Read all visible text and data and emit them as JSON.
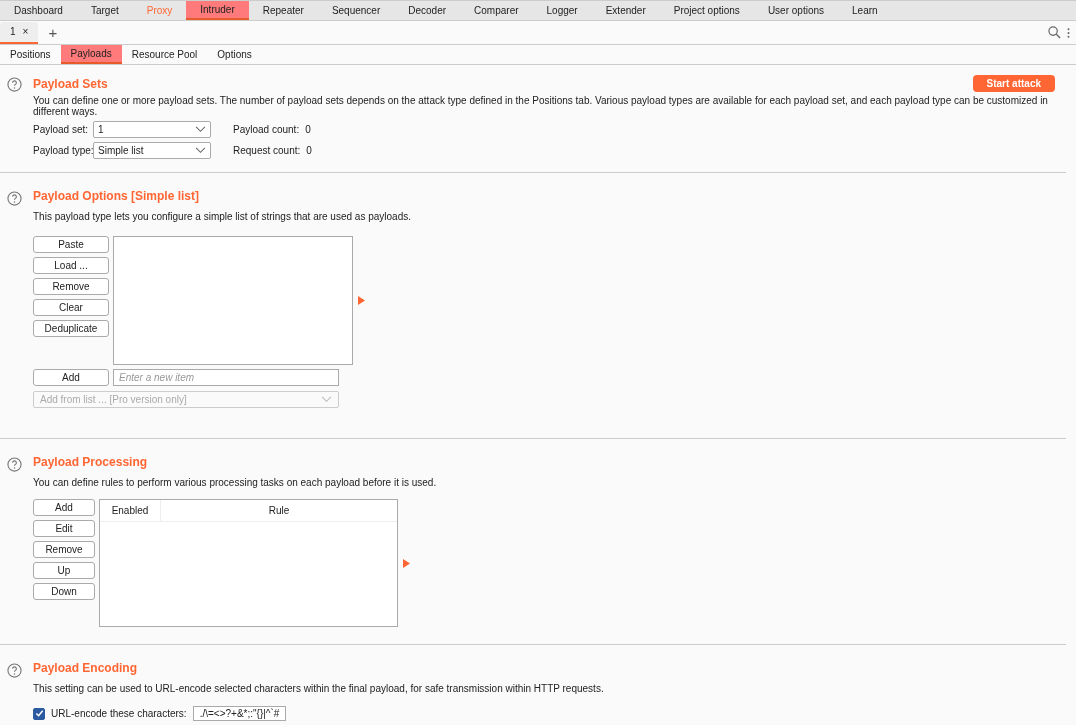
{
  "top_tabs": [
    {
      "label": "Dashboard",
      "selected": false,
      "highlighted": false
    },
    {
      "label": "Target",
      "selected": false,
      "highlighted": false
    },
    {
      "label": "Proxy",
      "selected": false,
      "highlighted": true
    },
    {
      "label": "Intruder",
      "selected": true,
      "highlighted": false
    },
    {
      "label": "Repeater",
      "selected": false,
      "highlighted": false
    },
    {
      "label": "Sequencer",
      "selected": false,
      "highlighted": false
    },
    {
      "label": "Decoder",
      "selected": false,
      "highlighted": false
    },
    {
      "label": "Comparer",
      "selected": false,
      "highlighted": false
    },
    {
      "label": "Logger",
      "selected": false,
      "highlighted": false
    },
    {
      "label": "Extender",
      "selected": false,
      "highlighted": false
    },
    {
      "label": "Project options",
      "selected": false,
      "highlighted": false
    },
    {
      "label": "User options",
      "selected": false,
      "highlighted": false
    },
    {
      "label": "Learn",
      "selected": false,
      "highlighted": false
    }
  ],
  "instance_tabs": [
    {
      "label": "1",
      "close": "×",
      "selected": true
    }
  ],
  "add_tab": "+",
  "sub_tabs": [
    {
      "label": "Positions",
      "selected": false
    },
    {
      "label": "Payloads",
      "selected": true
    },
    {
      "label": "Resource Pool",
      "selected": false
    },
    {
      "label": "Options",
      "selected": false
    }
  ],
  "payload_sets": {
    "title": "Payload Sets",
    "start_button": "Start attack",
    "description": "You can define one or more payload sets. The number of payload sets depends on the attack type defined in the Positions tab. Various payload types are available for each payload set, and each payload type can be customized in different ways.",
    "fields": [
      {
        "label": "Payload set:",
        "value": "1",
        "count_label": "Payload count:",
        "count": "0"
      },
      {
        "label": "Payload type:",
        "value": "Simple list",
        "count_label": "Request count:",
        "count": "0"
      }
    ]
  },
  "payload_options": {
    "title": "Payload Options [Simple list]",
    "description": "This payload type lets you configure a simple list of strings that are used as payloads.",
    "buttons": [
      "Paste",
      "Load ...",
      "Remove",
      "Clear",
      "Deduplicate"
    ],
    "add_button": "Add",
    "new_item_placeholder": "Enter a new item",
    "add_from_list": "Add from list ... [Pro version only]"
  },
  "payload_processing": {
    "title": "Payload Processing",
    "description": "You can define rules to perform various processing tasks on each payload before it is used.",
    "buttons": [
      "Add",
      "Edit",
      "Remove",
      "Up",
      "Down"
    ],
    "columns": [
      "Enabled",
      "Rule"
    ]
  },
  "payload_encoding": {
    "title": "Payload Encoding",
    "description": "This setting can be used to URL-encode selected characters within the final payload, for safe transmission within HTTP requests.",
    "checkbox_label": "URL-encode these characters:",
    "checked": true,
    "characters": "./\\=<>?+&*;:\"{}|^`#"
  }
}
